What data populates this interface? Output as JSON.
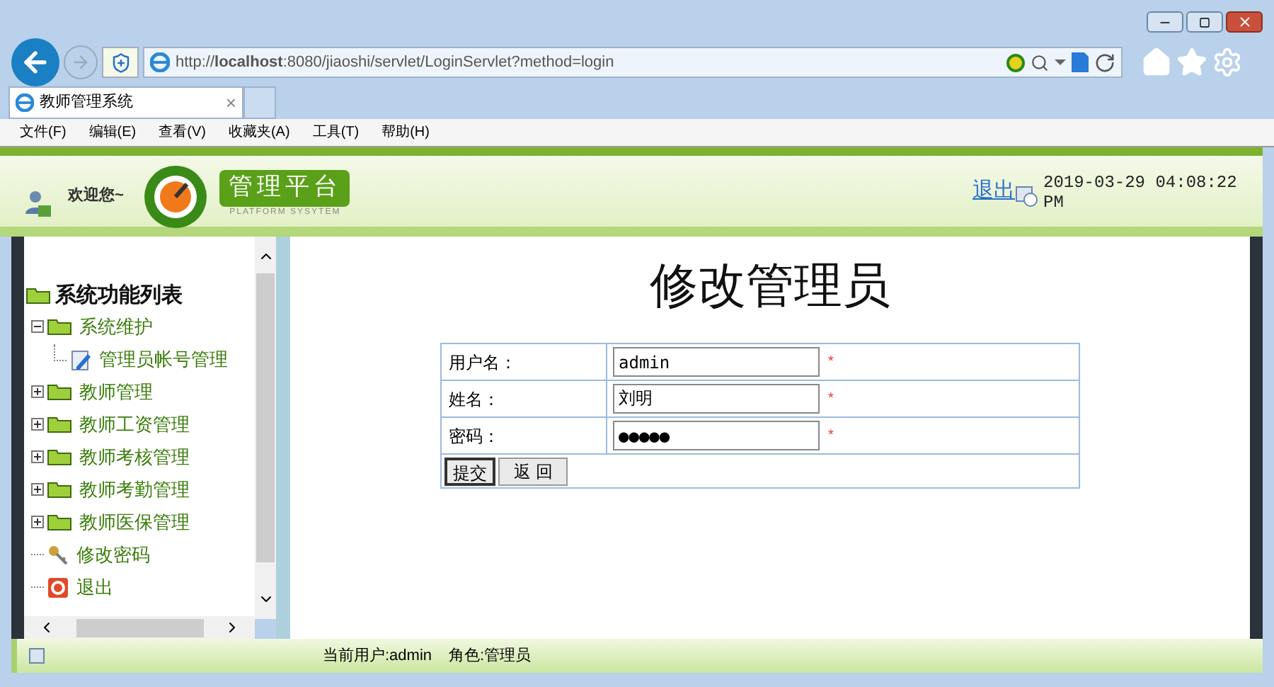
{
  "browser": {
    "url": "http://**localhost**:8080/jiaoshi/servlet/LoginServlet?method=login",
    "tab_title": "教师管理系统",
    "tab_close": "×",
    "menu": [
      "文件(F)",
      "编辑(E)",
      "查看(V)",
      "收藏夹(A)",
      "工具(T)",
      "帮助(H)"
    ]
  },
  "header": {
    "welcome": "欢迎您~",
    "logo_title": "管理平台",
    "logo_subtitle": "PLATFORM SYSYTEM",
    "logout": "退出",
    "datetime": "2019-03-29 04:08:22 PM"
  },
  "sidebar": {
    "title": "系统功能列表",
    "items": [
      {
        "label": "系统维护",
        "kind": "folder",
        "expanded": true,
        "children": [
          {
            "label": "管理员帐号管理",
            "kind": "edit"
          }
        ]
      },
      {
        "label": "教师管理",
        "kind": "folder",
        "expanded": false
      },
      {
        "label": "教师工资管理",
        "kind": "folder",
        "expanded": false
      },
      {
        "label": "教师考核管理",
        "kind": "folder",
        "expanded": false
      },
      {
        "label": "教师考勤管理",
        "kind": "folder",
        "expanded": false
      },
      {
        "label": "教师医保管理",
        "kind": "folder",
        "expanded": false
      },
      {
        "label": "修改密码",
        "kind": "key"
      },
      {
        "label": "退出",
        "kind": "exit"
      }
    ]
  },
  "form": {
    "title": "修改管理员",
    "fields": [
      {
        "label": "用户名：",
        "value": "admin",
        "required": "*"
      },
      {
        "label": "姓名：",
        "value": "刘明",
        "required": "*"
      },
      {
        "label": "密码：",
        "value": "●●●●●",
        "required": "*"
      }
    ],
    "buttons": [
      "提交",
      "返 回"
    ]
  },
  "status_bar": {
    "user": "当前用户:admin",
    "role": "角色:管理员"
  }
}
